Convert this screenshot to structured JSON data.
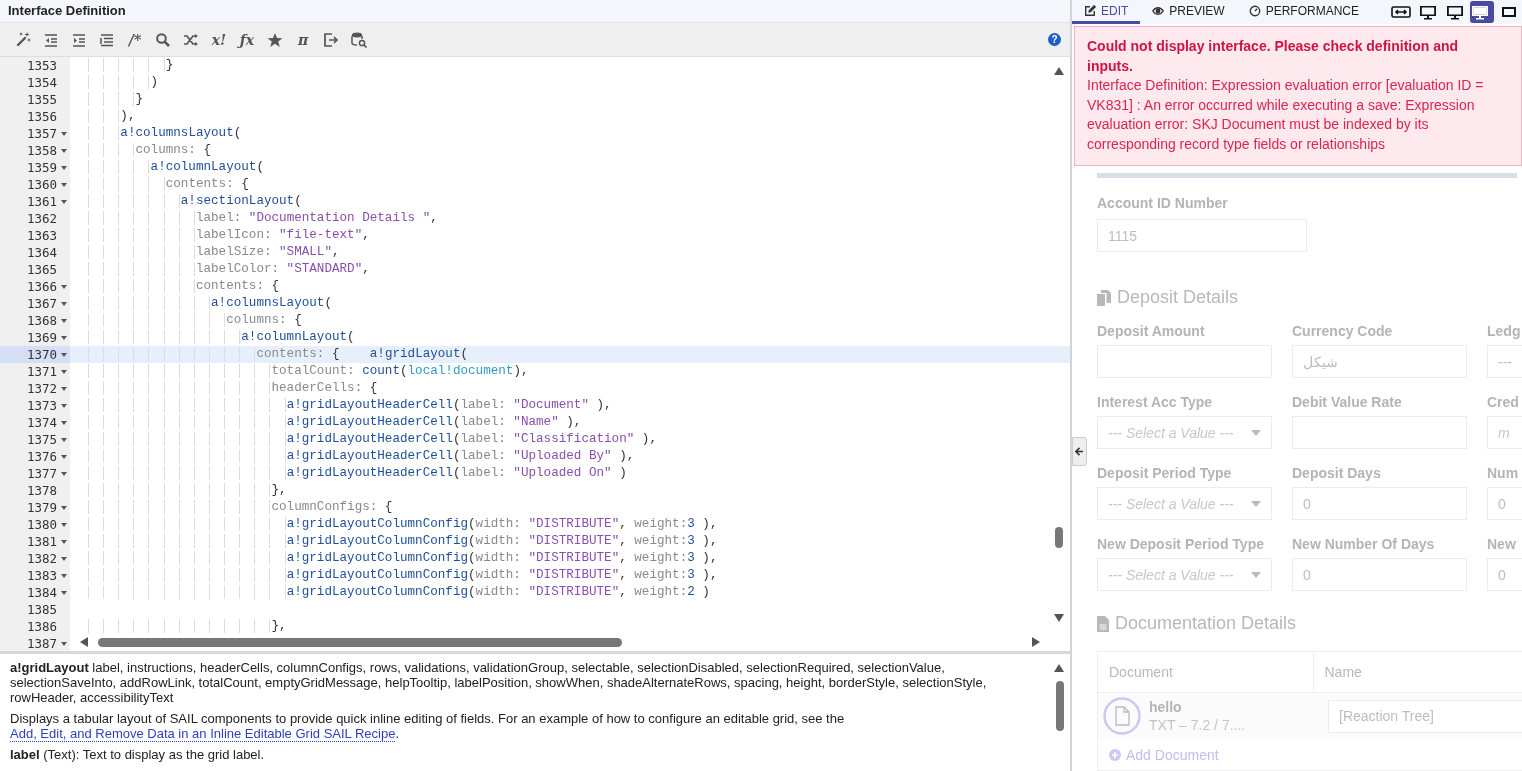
{
  "editor": {
    "title": "Interface Definition",
    "toolbar": [
      {
        "kind": "icon"
      },
      {
        "kind": "icon"
      },
      {
        "kind": "icon"
      },
      {
        "kind": "icon"
      },
      {
        "kind": "glyph",
        "text": "/*"
      },
      {
        "kind": "icon"
      },
      {
        "kind": "icon"
      },
      {
        "kind": "glyph",
        "text": "x!"
      },
      {
        "kind": "glyph",
        "text": "ƒx"
      },
      {
        "kind": "icon"
      },
      {
        "kind": "glyph",
        "text": "π"
      },
      {
        "kind": "icon"
      },
      {
        "kind": "icon"
      }
    ],
    "help": "?",
    "lines": [
      {
        "number": "1353",
        "foldable": false,
        "active": false,
        "tokens": [
          {
            "text": "            }",
            "kind": "punct"
          }
        ]
      },
      {
        "number": "1354",
        "foldable": false,
        "active": false,
        "tokens": [
          {
            "text": "          )",
            "kind": "punct"
          }
        ]
      },
      {
        "number": "1355",
        "foldable": false,
        "active": false,
        "tokens": [
          {
            "text": "        }",
            "kind": "punct"
          }
        ]
      },
      {
        "number": "1356",
        "foldable": false,
        "active": false,
        "tokens": [
          {
            "text": "      ),",
            "kind": "punct"
          }
        ]
      },
      {
        "number": "1357",
        "foldable": true,
        "active": false,
        "tokens": [
          {
            "text": "      a!columnsLayout",
            "kind": "function"
          },
          {
            "text": "(",
            "kind": "punct"
          }
        ]
      },
      {
        "number": "1358",
        "foldable": true,
        "active": false,
        "tokens": [
          {
            "text": "        columns:",
            "kind": "key"
          },
          {
            "text": " {",
            "kind": "punct"
          }
        ]
      },
      {
        "number": "1359",
        "foldable": true,
        "active": false,
        "tokens": [
          {
            "text": "          a!columnLayout",
            "kind": "function"
          },
          {
            "text": "(",
            "kind": "punct"
          }
        ]
      },
      {
        "number": "1360",
        "foldable": true,
        "active": false,
        "tokens": [
          {
            "text": "            contents:",
            "kind": "key"
          },
          {
            "text": " {",
            "kind": "punct"
          }
        ]
      },
      {
        "number": "1361",
        "foldable": true,
        "active": false,
        "tokens": [
          {
            "text": "              a!sectionLayout",
            "kind": "function"
          },
          {
            "text": "(",
            "kind": "punct"
          }
        ]
      },
      {
        "number": "1362",
        "foldable": false,
        "active": false,
        "tokens": [
          {
            "text": "                label:",
            "kind": "key"
          },
          {
            "text": " \"Documentation Details \"",
            "kind": "string"
          },
          {
            "text": ",",
            "kind": "punct"
          }
        ]
      },
      {
        "number": "1363",
        "foldable": false,
        "active": false,
        "tokens": [
          {
            "text": "                labelIcon:",
            "kind": "key"
          },
          {
            "text": " \"file-text\"",
            "kind": "string"
          },
          {
            "text": ",",
            "kind": "punct"
          }
        ]
      },
      {
        "number": "1364",
        "foldable": false,
        "active": false,
        "tokens": [
          {
            "text": "                labelSize:",
            "kind": "key"
          },
          {
            "text": " \"SMALL\"",
            "kind": "string"
          },
          {
            "text": ",",
            "kind": "punct"
          }
        ]
      },
      {
        "number": "1365",
        "foldable": false,
        "active": false,
        "tokens": [
          {
            "text": "                labelColor:",
            "kind": "key"
          },
          {
            "text": " \"STANDARD\"",
            "kind": "string"
          },
          {
            "text": ",",
            "kind": "punct"
          }
        ]
      },
      {
        "number": "1366",
        "foldable": true,
        "active": false,
        "tokens": [
          {
            "text": "                contents:",
            "kind": "key"
          },
          {
            "text": " {",
            "kind": "punct"
          }
        ]
      },
      {
        "number": "1367",
        "foldable": true,
        "active": false,
        "tokens": [
          {
            "text": "                  a!columnsLayout",
            "kind": "function"
          },
          {
            "text": "(",
            "kind": "punct"
          }
        ]
      },
      {
        "number": "1368",
        "foldable": true,
        "active": false,
        "tokens": [
          {
            "text": "                    columns:",
            "kind": "key"
          },
          {
            "text": " {",
            "kind": "punct"
          }
        ]
      },
      {
        "number": "1369",
        "foldable": true,
        "active": false,
        "tokens": [
          {
            "text": "                      a!columnLayout",
            "kind": "function"
          },
          {
            "text": "(",
            "kind": "punct"
          }
        ]
      },
      {
        "number": "1370",
        "foldable": true,
        "active": true,
        "tokens": [
          {
            "text": "                        contents:",
            "kind": "key"
          },
          {
            "text": " {    ",
            "kind": "punct"
          },
          {
            "text": "a!gridLayout",
            "kind": "function"
          },
          {
            "text": "(",
            "kind": "punct"
          }
        ]
      },
      {
        "number": "1371",
        "foldable": true,
        "active": false,
        "tokens": [
          {
            "text": "                          totalCount:",
            "kind": "key"
          },
          {
            "text": " count",
            "kind": "function"
          },
          {
            "text": "(",
            "kind": "punct"
          },
          {
            "text": "local!document",
            "kind": "local"
          },
          {
            "text": "),",
            "kind": "punct"
          }
        ]
      },
      {
        "number": "1372",
        "foldable": true,
        "active": false,
        "tokens": [
          {
            "text": "                          headerCells:",
            "kind": "key"
          },
          {
            "text": " {",
            "kind": "punct"
          }
        ]
      },
      {
        "number": "1373",
        "foldable": true,
        "active": false,
        "tokens": [
          {
            "text": "                            a!gridLayoutHeaderCell",
            "kind": "function"
          },
          {
            "text": "(",
            "kind": "punct"
          },
          {
            "text": "label:",
            "kind": "key"
          },
          {
            "text": " \"Document\"",
            "kind": "string"
          },
          {
            "text": " ),",
            "kind": "punct"
          }
        ]
      },
      {
        "number": "1374",
        "foldable": true,
        "active": false,
        "tokens": [
          {
            "text": "                            a!gridLayoutHeaderCell",
            "kind": "function"
          },
          {
            "text": "(",
            "kind": "punct"
          },
          {
            "text": "label:",
            "kind": "key"
          },
          {
            "text": " \"Name\"",
            "kind": "string"
          },
          {
            "text": " ),",
            "kind": "punct"
          }
        ]
      },
      {
        "number": "1375",
        "foldable": true,
        "active": false,
        "tokens": [
          {
            "text": "                            a!gridLayoutHeaderCell",
            "kind": "function"
          },
          {
            "text": "(",
            "kind": "punct"
          },
          {
            "text": "label:",
            "kind": "key"
          },
          {
            "text": " \"Classification\"",
            "kind": "string"
          },
          {
            "text": " ),",
            "kind": "punct"
          }
        ]
      },
      {
        "number": "1376",
        "foldable": true,
        "active": false,
        "tokens": [
          {
            "text": "                            a!gridLayoutHeaderCell",
            "kind": "function"
          },
          {
            "text": "(",
            "kind": "punct"
          },
          {
            "text": "label:",
            "kind": "key"
          },
          {
            "text": " \"Uploaded By\"",
            "kind": "string"
          },
          {
            "text": " ),",
            "kind": "punct"
          }
        ]
      },
      {
        "number": "1377",
        "foldable": true,
        "active": false,
        "tokens": [
          {
            "text": "                            a!gridLayoutHeaderCell",
            "kind": "function"
          },
          {
            "text": "(",
            "kind": "punct"
          },
          {
            "text": "label:",
            "kind": "key"
          },
          {
            "text": " \"Uploaded On\"",
            "kind": "string"
          },
          {
            "text": " )",
            "kind": "punct"
          }
        ]
      },
      {
        "number": "1378",
        "foldable": false,
        "active": false,
        "tokens": [
          {
            "text": "                          },",
            "kind": "punct"
          }
        ]
      },
      {
        "number": "1379",
        "foldable": true,
        "active": false,
        "tokens": [
          {
            "text": "                          columnConfigs:",
            "kind": "key"
          },
          {
            "text": " {",
            "kind": "punct"
          }
        ]
      },
      {
        "number": "1380",
        "foldable": true,
        "active": false,
        "tokens": [
          {
            "text": "                            a!gridLayoutColumnConfig",
            "kind": "function"
          },
          {
            "text": "(",
            "kind": "punct"
          },
          {
            "text": "width:",
            "kind": "key"
          },
          {
            "text": " \"DISTRIBUTE\"",
            "kind": "string"
          },
          {
            "text": ", ",
            "kind": "punct"
          },
          {
            "text": "weight:",
            "kind": "key"
          },
          {
            "text": "3",
            "kind": "number"
          },
          {
            "text": " ),",
            "kind": "punct"
          }
        ]
      },
      {
        "number": "1381",
        "foldable": true,
        "active": false,
        "tokens": [
          {
            "text": "                            a!gridLayoutColumnConfig",
            "kind": "function"
          },
          {
            "text": "(",
            "kind": "punct"
          },
          {
            "text": "width:",
            "kind": "key"
          },
          {
            "text": " \"DISTRIBUTE\"",
            "kind": "string"
          },
          {
            "text": ", ",
            "kind": "punct"
          },
          {
            "text": "weight:",
            "kind": "key"
          },
          {
            "text": "3",
            "kind": "number"
          },
          {
            "text": " ),",
            "kind": "punct"
          }
        ]
      },
      {
        "number": "1382",
        "foldable": true,
        "active": false,
        "tokens": [
          {
            "text": "                            a!gridLayoutColumnConfig",
            "kind": "function"
          },
          {
            "text": "(",
            "kind": "punct"
          },
          {
            "text": "width:",
            "kind": "key"
          },
          {
            "text": " \"DISTRIBUTE\"",
            "kind": "string"
          },
          {
            "text": ", ",
            "kind": "punct"
          },
          {
            "text": "weight:",
            "kind": "key"
          },
          {
            "text": "3",
            "kind": "number"
          },
          {
            "text": " ),",
            "kind": "punct"
          }
        ]
      },
      {
        "number": "1383",
        "foldable": true,
        "active": false,
        "tokens": [
          {
            "text": "                            a!gridLayoutColumnConfig",
            "kind": "function"
          },
          {
            "text": "(",
            "kind": "punct"
          },
          {
            "text": "width:",
            "kind": "key"
          },
          {
            "text": " \"DISTRIBUTE\"",
            "kind": "string"
          },
          {
            "text": ", ",
            "kind": "punct"
          },
          {
            "text": "weight:",
            "kind": "key"
          },
          {
            "text": "3",
            "kind": "number"
          },
          {
            "text": " ),",
            "kind": "punct"
          }
        ]
      },
      {
        "number": "1384",
        "foldable": true,
        "active": false,
        "tokens": [
          {
            "text": "                            a!gridLayoutColumnConfig",
            "kind": "function"
          },
          {
            "text": "(",
            "kind": "punct"
          },
          {
            "text": "width:",
            "kind": "key"
          },
          {
            "text": " \"DISTRIBUTE\"",
            "kind": "string"
          },
          {
            "text": ", ",
            "kind": "punct"
          },
          {
            "text": "weight:",
            "kind": "key"
          },
          {
            "text": "2",
            "kind": "number"
          },
          {
            "text": " )",
            "kind": "punct"
          }
        ]
      },
      {
        "number": "1385",
        "foldable": false,
        "active": false
      },
      {
        "number": "1386",
        "foldable": false,
        "active": false,
        "tokens": [
          {
            "text": "                          },",
            "kind": "punct"
          }
        ]
      },
      {
        "number": "1387",
        "foldable": true,
        "active": false
      }
    ]
  },
  "docs": {
    "signature": "**a!gridLayout**  label, instructions, headerCells, columnConfigs, rows, validations, validationGroup, selectable, selectionDisabled, selectionRequired, selectionValue, selectionSaveInto, addRowLink, totalCount, emptyGridMessage, helpTooltip, labelPosition, showWhen, shadeAlternateRows, spacing, height, borderStyle, selectionStyle, rowHeader, accessibilityText",
    "description": "Displays a tabular layout of SAIL components to provide quick inline editing of fields. For an example of how to configure an editable grid, see the ",
    "link": "Add, Edit, and Remove Data in an Inline Editable Grid SAIL Recipe",
    "description_end": ".",
    "param": "**label** (Text): Text to display as the grid label."
  },
  "preview": {
    "tabs": [
      {
        "label": "EDIT",
        "selected": true
      },
      {
        "label": "PREVIEW",
        "selected": false
      },
      {
        "label": "PERFORMANCE",
        "selected": false
      }
    ],
    "devices": [
      {
        "selected": false
      },
      {
        "selected": false
      },
      {
        "selected": false
      },
      {
        "selected": true
      },
      {
        "selected": false
      }
    ],
    "error": {
      "title": "Could not display interface. Please check definition and inputs.",
      "message": "Interface Definition: Expression evaluation error [evaluation ID = VK831] : An error occurred while executing a save: Expression evaluation error: SKJ Document must be indexed by its corresponding record type fields or relationships"
    },
    "account_field": {
      "label": "Account ID Number",
      "value": "1115"
    },
    "deposit": {
      "title": "Deposit Details",
      "fields": [
        {
          "label": "Deposit Amount",
          "kind": "text"
        },
        {
          "label": "Currency Code",
          "kind": "text",
          "value": "شيكل"
        },
        {
          "label": "Ledg",
          "kind": "text",
          "value": "---"
        },
        {
          "label": "Interest Acc Type",
          "kind": "select",
          "placeholder": "--- Select a Value ---"
        },
        {
          "label": "Debit Value Rate",
          "kind": "text"
        },
        {
          "label": "Cred",
          "kind": "text",
          "placeholder": "m"
        },
        {
          "label": "Deposit Period Type",
          "kind": "select",
          "placeholder": "--- Select a Value ---"
        },
        {
          "label": "Deposit Days",
          "kind": "text",
          "value": "0"
        },
        {
          "label": "Num",
          "kind": "text",
          "value": "0"
        },
        {
          "label": "New Deposit Period Type",
          "kind": "select",
          "placeholder": "--- Select a Value ---"
        },
        {
          "label": "New Number Of Days",
          "kind": "text",
          "value": "0"
        },
        {
          "label": "New",
          "kind": "text",
          "value": "0"
        }
      ]
    },
    "documents": {
      "title": "Documentation Details",
      "columns": [
        "Document",
        "Name"
      ],
      "rows": [
        {
          "name": "hello",
          "meta": "TXT – 7.2 / 7....",
          "name_value": "[Reaction Tree]"
        }
      ],
      "add_link": "Add Document"
    }
  }
}
